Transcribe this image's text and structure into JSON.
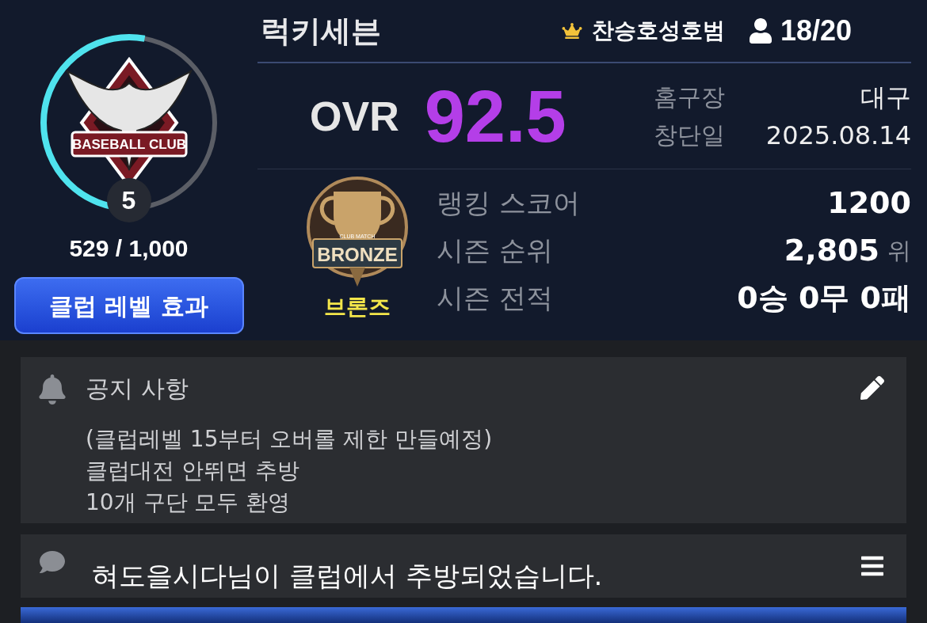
{
  "club": {
    "emblem_text": "BASEBALL CLUB",
    "level": "5",
    "progress": {
      "level": 0.529,
      "text": "529 / 1,000"
    },
    "level_button": "클럽 레벨 효과",
    "name": "럭키세븐",
    "leader": "찬승호성호범",
    "members": "18/20"
  },
  "ovr": {
    "label": "OVR",
    "value": "92.5"
  },
  "info": [
    {
      "label": "홈구장",
      "value": "대구"
    },
    {
      "label": "창단일",
      "value": "2025.08.14"
    }
  ],
  "tier": {
    "badge_top": "CLUB MATCH",
    "badge_text": "BRONZE",
    "name": "브론즈"
  },
  "stats": [
    {
      "label": "랭킹 스코어",
      "value": "1200"
    },
    {
      "label": "시즌 순위",
      "value": "2,805",
      "unit": "위"
    },
    {
      "label": "시즌 전적",
      "value": "0승 0무 0패"
    }
  ],
  "notice": {
    "title": "공지 사항",
    "lines": [
      "(클럽레벨 15부터 오버롤 제한 만들예정)",
      "클럽대전 안뛰면 추방",
      "10개 구단 모두 환영"
    ]
  },
  "chat": {
    "message": "혀도을시다님이 클럽에서 추방되었습니다."
  }
}
